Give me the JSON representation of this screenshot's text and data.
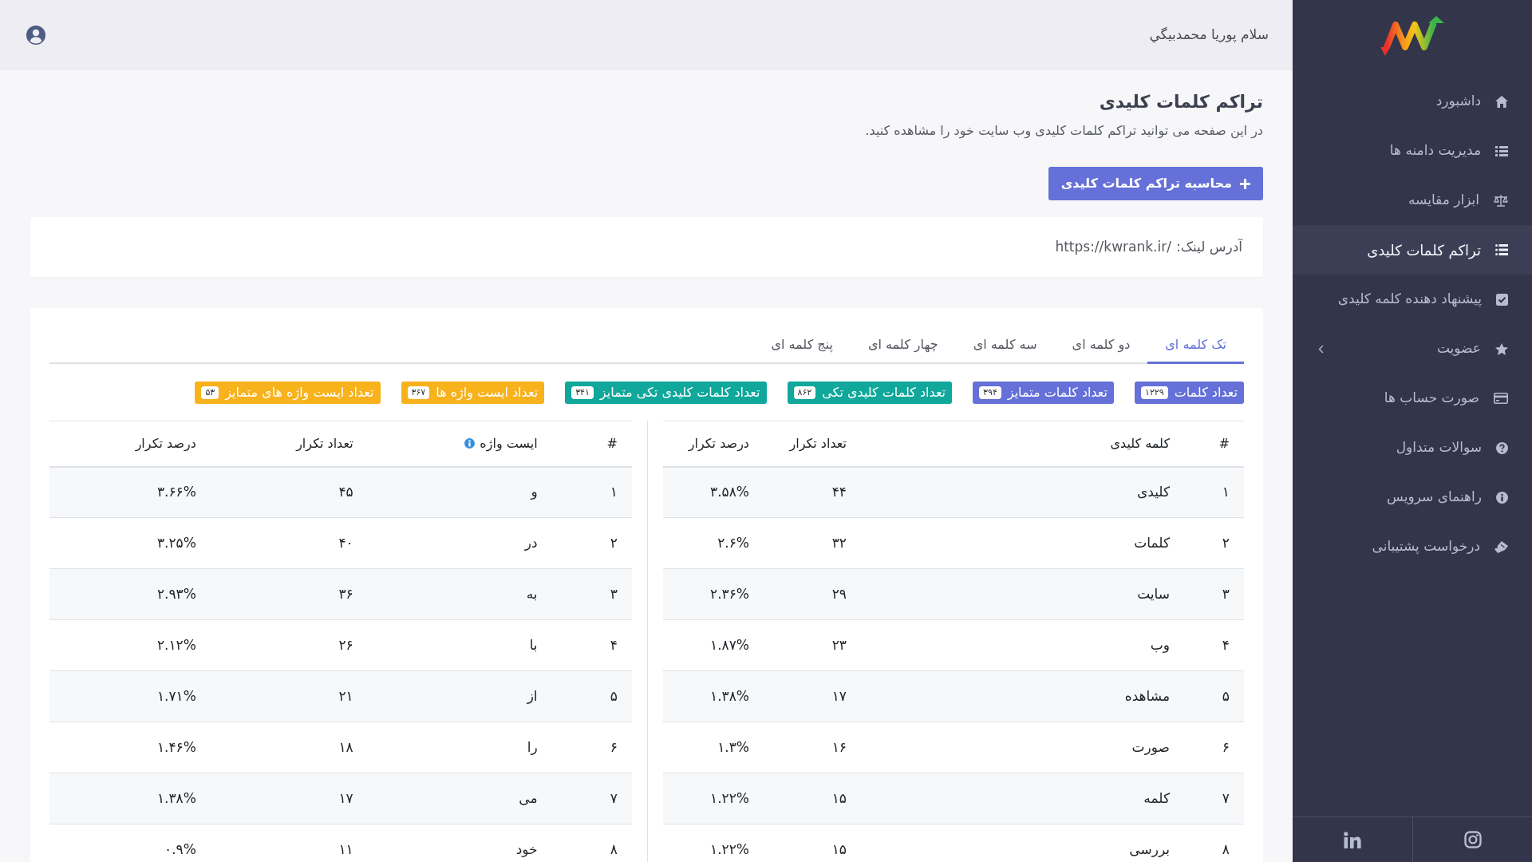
{
  "sidebar": {
    "items": [
      {
        "label": "داشبورد",
        "kind": "link",
        "selected": false
      },
      {
        "label": "مدیریت دامنه ها",
        "kind": "link",
        "selected": false
      },
      {
        "label": "ابزار مقایسه",
        "kind": "link",
        "selected": false
      },
      {
        "label": "تراکم کلمات کلیدی",
        "kind": "link",
        "selected": true
      },
      {
        "label": "پیشنهاد دهنده کلمه کلیدی",
        "kind": "link",
        "selected": false
      },
      {
        "label": "عضویت",
        "kind": "submenu",
        "selected": false
      },
      {
        "label": "صورت حساب ها",
        "kind": "link",
        "selected": false
      },
      {
        "label": "سوالات متداول",
        "kind": "link",
        "selected": false
      },
      {
        "label": "راهنمای سرویس",
        "kind": "link",
        "selected": false
      },
      {
        "label": "درخواست پشتیبانی",
        "kind": "link",
        "selected": false
      }
    ]
  },
  "header": {
    "greeting": "سلام پوریا محمدبیگي"
  },
  "page": {
    "title": "تراکم کلمات کلیدی",
    "description": "در این صفحه می توانید تراکم کلمات کلیدی وب سایت خود را مشاهده کنید.",
    "action_button": "محاسبه تراکم کلمات کلیدی"
  },
  "link_card": {
    "label": "آدرس لینک:",
    "url": "https://kwrank.ir/"
  },
  "tabs": [
    {
      "label": "تک کلمه ای",
      "selected": true
    },
    {
      "label": "دو کلمه ای",
      "selected": false
    },
    {
      "label": "سه کلمه ای",
      "selected": false
    },
    {
      "label": "چهار کلمه ای",
      "selected": false
    },
    {
      "label": "پنج کلمه ای",
      "selected": false
    }
  ],
  "stats": [
    {
      "label": "تعداد کلمات",
      "count": "۱۲۲۹",
      "color": "#6571d8"
    },
    {
      "label": "تعداد کلمات متمایز",
      "count": "۳۹۴",
      "color": "#6571d8"
    },
    {
      "label": "تعداد کلمات کلیدی تکی",
      "count": "۸۶۲",
      "color": "#10a89b"
    },
    {
      "label": "تعداد کلمات کلیدی تکی متمایز",
      "count": "۳۴۱",
      "color": "#10a89b"
    },
    {
      "label": "تعداد ایست واژه ها",
      "count": "۳۶۷",
      "color": "#f8b21c"
    },
    {
      "label": "تعداد ایست واژه های متمایز",
      "count": "۵۳",
      "color": "#f8b21c"
    }
  ],
  "keywords_table": {
    "columns": [
      "#",
      "کلمه کلیدی",
      "تعداد تکرار",
      "درصد تکرار"
    ],
    "rows": [
      [
        "۱",
        "کلیدی",
        "۴۴",
        "۳.۵۸%"
      ],
      [
        "۲",
        "کلمات",
        "۳۲",
        "۲.۶%"
      ],
      [
        "۳",
        "سایت",
        "۲۹",
        "۲.۳۶%"
      ],
      [
        "۴",
        "وب",
        "۲۳",
        "۱.۸۷%"
      ],
      [
        "۵",
        "مشاهده",
        "۱۷",
        "۱.۳۸%"
      ],
      [
        "۶",
        "صورت",
        "۱۶",
        "۱.۳%"
      ],
      [
        "۷",
        "کلمه",
        "۱۵",
        "۱.۲۲%"
      ],
      [
        "۸",
        "بررسی",
        "۱۵",
        "۱.۲۲%"
      ]
    ]
  },
  "stopwords_table": {
    "columns": [
      "#",
      "ایست واژه",
      "تعداد تکرار",
      "درصد تکرار"
    ],
    "rows": [
      [
        "۱",
        "و",
        "۴۵",
        "۳.۶۶%"
      ],
      [
        "۲",
        "در",
        "۴۰",
        "۳.۲۵%"
      ],
      [
        "۳",
        "به",
        "۳۶",
        "۲.۹۳%"
      ],
      [
        "۴",
        "با",
        "۲۶",
        "۲.۱۲%"
      ],
      [
        "۵",
        "از",
        "۲۱",
        "۱.۷۱%"
      ],
      [
        "۶",
        "را",
        "۱۸",
        "۱.۴۶%"
      ],
      [
        "۷",
        "می",
        "۱۷",
        "۱.۳۸%"
      ],
      [
        "۸",
        "خود",
        "۱۱",
        "۰.۹%"
      ]
    ]
  }
}
